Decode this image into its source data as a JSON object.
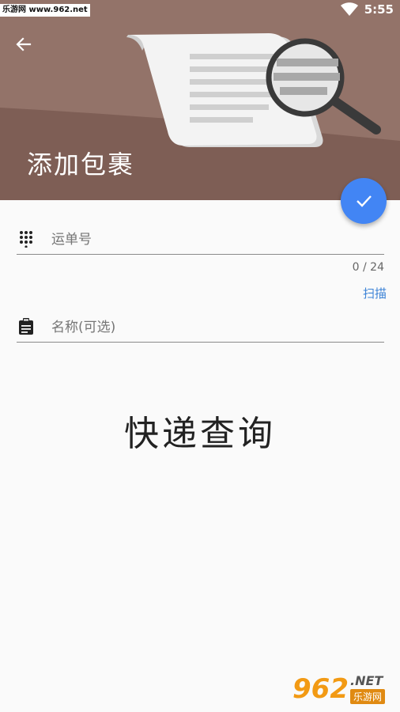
{
  "status_bar": {
    "watermark": "乐游网 www.962.net",
    "time": "5:55"
  },
  "header": {
    "title": "添加包裹",
    "back_icon": "arrow-left-icon",
    "illustration_icon": "document-magnifier-icon"
  },
  "fab": {
    "icon": "check-icon",
    "color": "#4285f4"
  },
  "form": {
    "tracking": {
      "placeholder": "运单号",
      "value": "",
      "icon": "dialpad-icon",
      "counter": "0 / 24"
    },
    "scan_label": "扫描",
    "name": {
      "placeholder": "名称(可选)",
      "value": "",
      "icon": "clipboard-icon"
    }
  },
  "splash_text": "快递查询",
  "watermark": {
    "number": "962",
    "suffix": ".NET",
    "site_name": "乐游网"
  },
  "colors": {
    "header_bg": "#7e5e55",
    "header_bg_light": "#937369",
    "accent": "#4285f4",
    "link": "#3b82d6",
    "page_bg": "#fafafa"
  }
}
